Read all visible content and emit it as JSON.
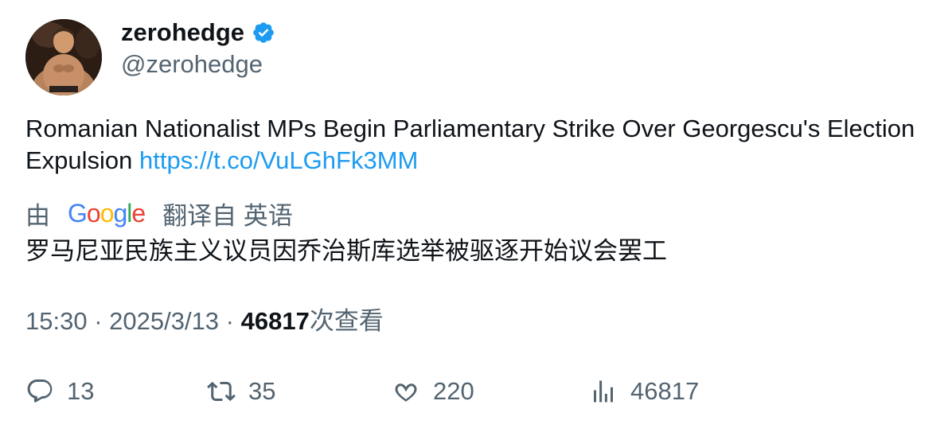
{
  "author": {
    "display_name": "zerohedge",
    "handle": "@zerohedge",
    "verified_icon": "verified-badge-icon",
    "badge_color": "#1d9bf0"
  },
  "tweet": {
    "text": "Romanian Nationalist MPs Begin Parliamentary Strike Over Georgescu's Election Expulsion ",
    "link": "https://t.co/VuLGhFk3MM",
    "link_color": "#1d9bf0"
  },
  "translation": {
    "by_label": "由",
    "google_logo": "Google",
    "from_label": "翻译自 英语",
    "text": "罗马尼亚民族主义议员因乔治斯库选举被驱逐开始议会罢工"
  },
  "meta": {
    "time": "15:30",
    "separator": " · ",
    "date": "2025/3/13",
    "views_count": "46817",
    "views_label": "次查看"
  },
  "actions": {
    "replies": "13",
    "retweets": "35",
    "likes": "220",
    "views": "46817"
  }
}
